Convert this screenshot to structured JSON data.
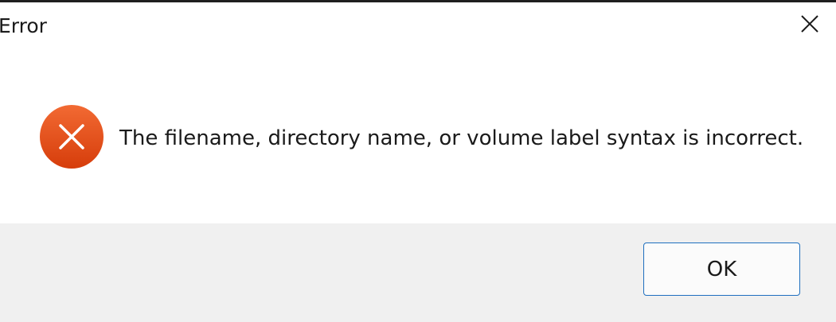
{
  "window": {
    "title": "Error"
  },
  "icons": {
    "close": "close-icon",
    "error": "error-icon"
  },
  "dialog": {
    "message": "The filename, directory name, or volume label syntax is incorrect.",
    "ok_label": "OK"
  },
  "colors": {
    "error_icon_top": "#f0652f",
    "error_icon_bottom": "#d9410e",
    "button_border": "#1f6fbf",
    "footer_bg": "#f0f0f0"
  }
}
